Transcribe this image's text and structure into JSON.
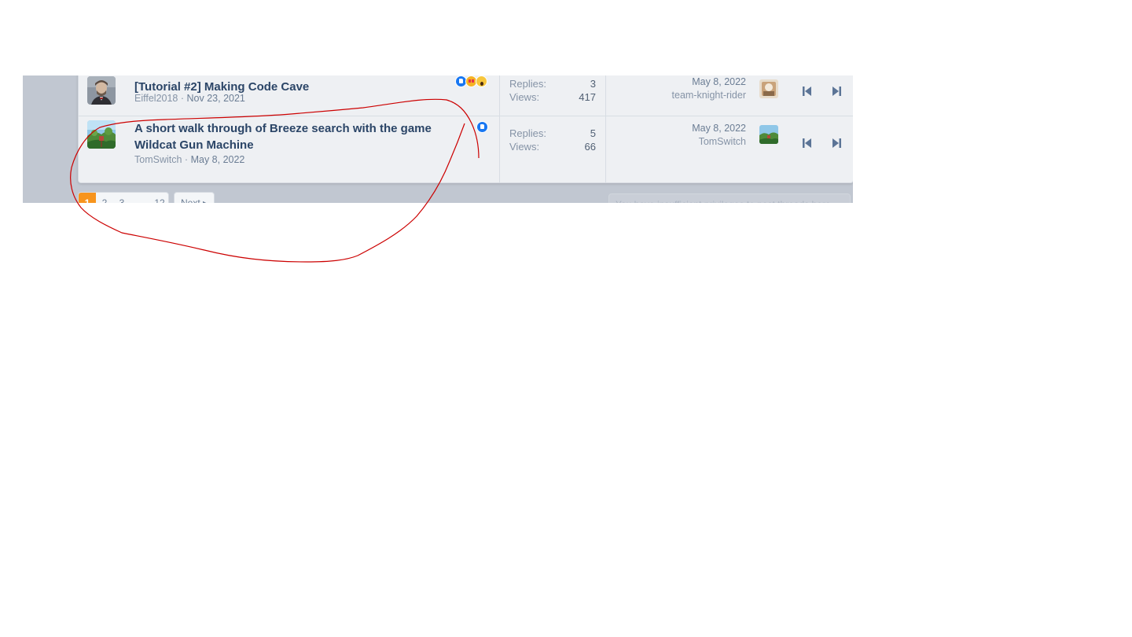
{
  "threads": [
    {
      "title": "[Tutorial #2] Making Code Cave",
      "author": "Eiffel2018",
      "started": "Nov 23, 2021",
      "reactions": [
        "like-icon",
        "love-icon",
        "wow-icon"
      ],
      "replies_label": "Replies:",
      "replies": "3",
      "views_label": "Views:",
      "views": "417",
      "last_date": "May 8, 2022",
      "last_user": "team-knight-rider"
    },
    {
      "title": "A short walk through of Breeze search with the game Wildcat Gun Machine",
      "author": "TomSwitch",
      "started": "May 8, 2022",
      "reactions": [
        "like-icon"
      ],
      "replies_label": "Replies:",
      "replies": "5",
      "views_label": "Views:",
      "views": "66",
      "last_date": "May 8, 2022",
      "last_user": "TomSwitch"
    }
  ],
  "separator": "·",
  "pagination": {
    "pages": [
      "1",
      "2",
      "3",
      "…",
      "12"
    ],
    "current": "1",
    "next_label": "Next ▸"
  },
  "notice": "You have insufficient privileges to post threads here.",
  "colors": {
    "accent": "#f7941d",
    "title": "#2b4567",
    "annotation": "#cc0000",
    "like": "#1877f2"
  }
}
